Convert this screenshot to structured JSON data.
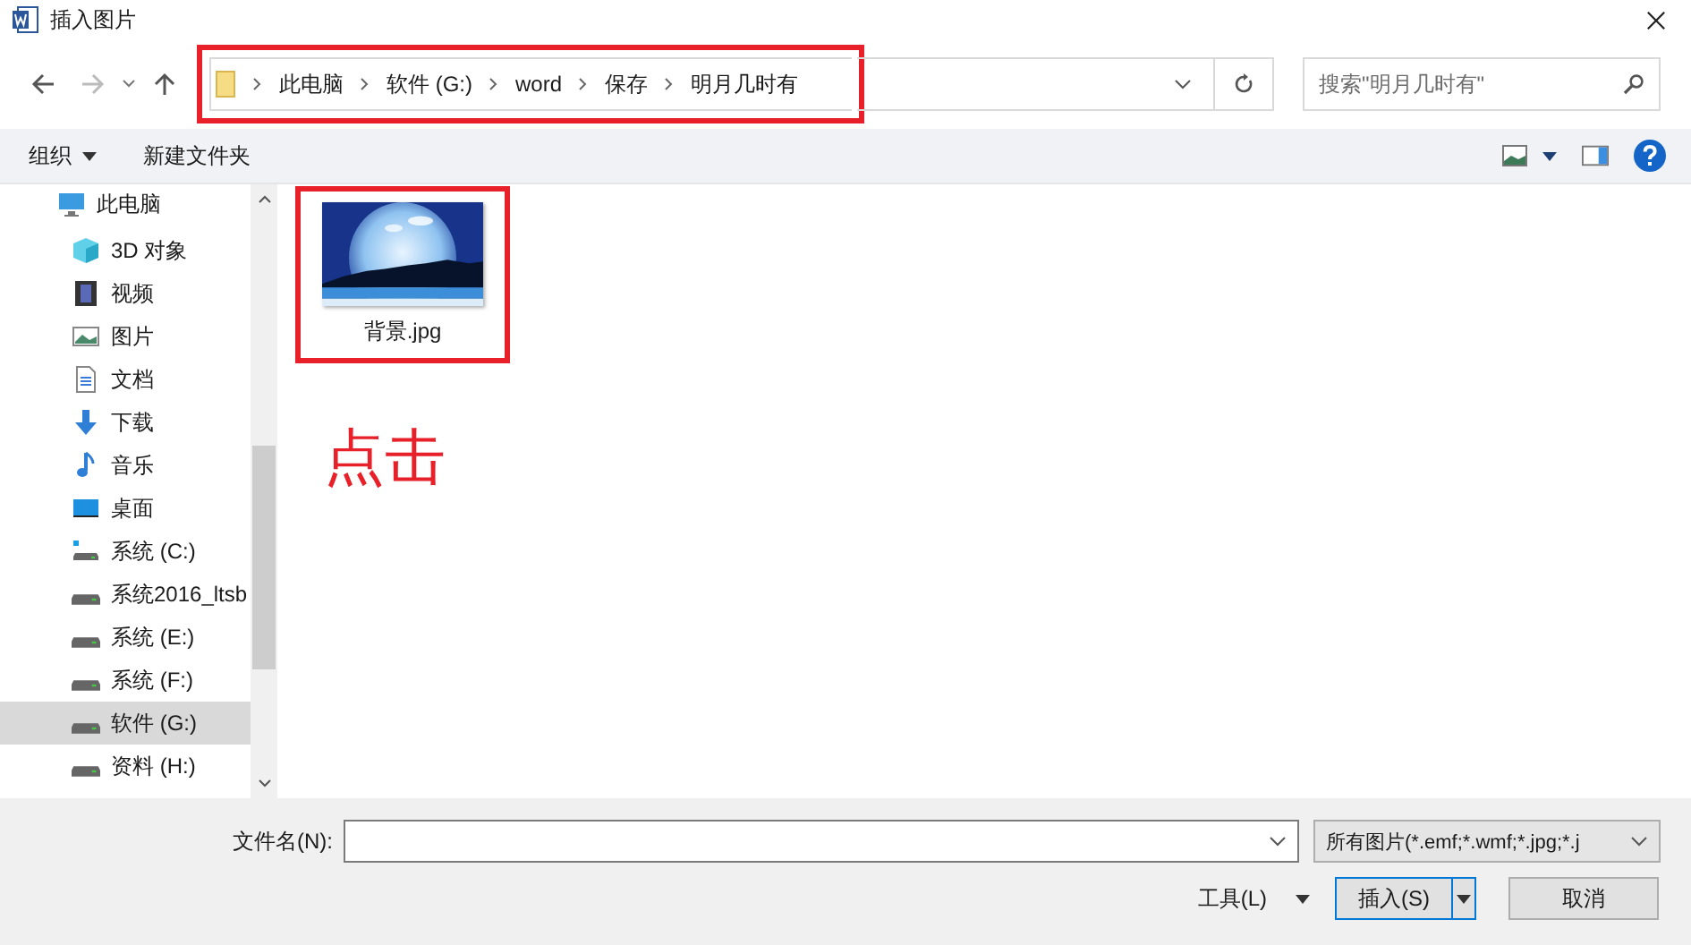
{
  "window": {
    "title": "插入图片"
  },
  "address": {
    "path": [
      "此电脑",
      "软件 (G:)",
      "word",
      "保存",
      "明月几时有"
    ],
    "highlighted": true
  },
  "search": {
    "placeholder": "搜索\"明月几时有\""
  },
  "toolbar": {
    "organize": "组织",
    "new_folder": "新建文件夹"
  },
  "nav_tree": [
    {
      "label": "此电脑",
      "kind": "pc",
      "selected": false,
      "children": [
        {
          "label": "3D 对象",
          "kind": "cube",
          "selected": false
        },
        {
          "label": "视频",
          "kind": "video",
          "selected": false
        },
        {
          "label": "图片",
          "kind": "pictures",
          "selected": false
        },
        {
          "label": "文档",
          "kind": "document",
          "selected": false
        },
        {
          "label": "下载",
          "kind": "download",
          "selected": false
        },
        {
          "label": "音乐",
          "kind": "music",
          "selected": false
        },
        {
          "label": "桌面",
          "kind": "desktop",
          "selected": false
        },
        {
          "label": "系统 (C:)",
          "kind": "system-drive",
          "selected": false
        },
        {
          "label": "系统2016_ltsb",
          "kind": "drive",
          "selected": false
        },
        {
          "label": "系统 (E:)",
          "kind": "drive",
          "selected": false
        },
        {
          "label": "系统 (F:)",
          "kind": "drive",
          "selected": false
        },
        {
          "label": "软件 (G:)",
          "kind": "drive",
          "selected": true
        },
        {
          "label": "资料 (H:)",
          "kind": "drive",
          "selected": false
        }
      ]
    }
  ],
  "files": [
    {
      "name": "背景.jpg",
      "kind": "picture",
      "highlighted": true
    }
  ],
  "annotation": "点击",
  "bottom": {
    "filename_label": "文件名(N):",
    "filetype": "所有图片(*.emf;*.wmf;*.jpg;*.j",
    "tools": "工具(L)",
    "insert": "插入(S)",
    "cancel": "取消"
  }
}
